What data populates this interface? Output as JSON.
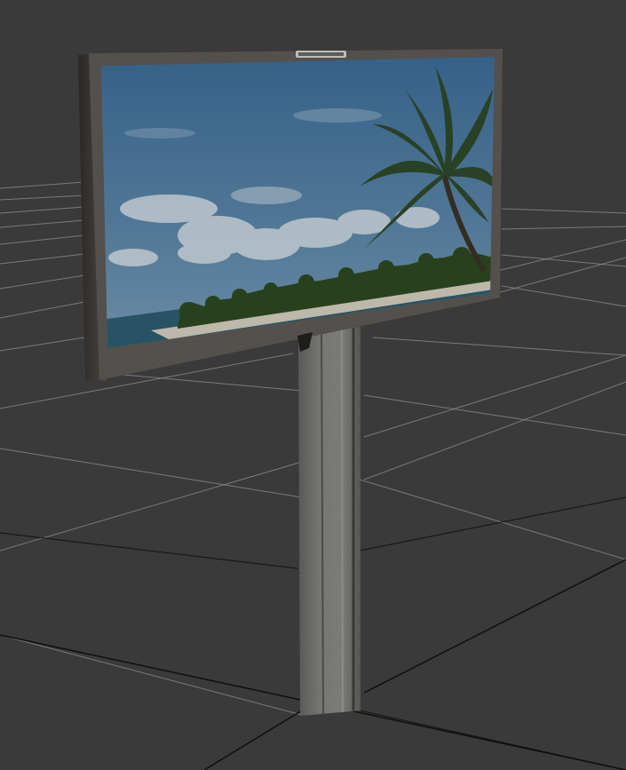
{
  "viewport": {
    "background_color": "#3a3a3a",
    "grid_line_color": "#8a8a8a",
    "grid_major_color": "#0e0e0e"
  },
  "billboard": {
    "sign_plate_text": "",
    "frame_color": "#4a4642",
    "frame_edge_color": "#2a2724",
    "sky_top_color": "#3d6f9c",
    "sky_bottom_color": "#7a9fbc",
    "cloud_color": "#d9e3ea",
    "sand_color": "#d8d2c2",
    "sea_color": "#2d5f74",
    "treeline_color": "#2d4a22",
    "palm_leaf_color": "#2f4a2a",
    "palm_trunk_color": "#3b3427"
  },
  "post": {
    "front_color": "#6d6d6b",
    "side_color": "#4e4e4c",
    "highlight_color": "#8a8a86"
  }
}
